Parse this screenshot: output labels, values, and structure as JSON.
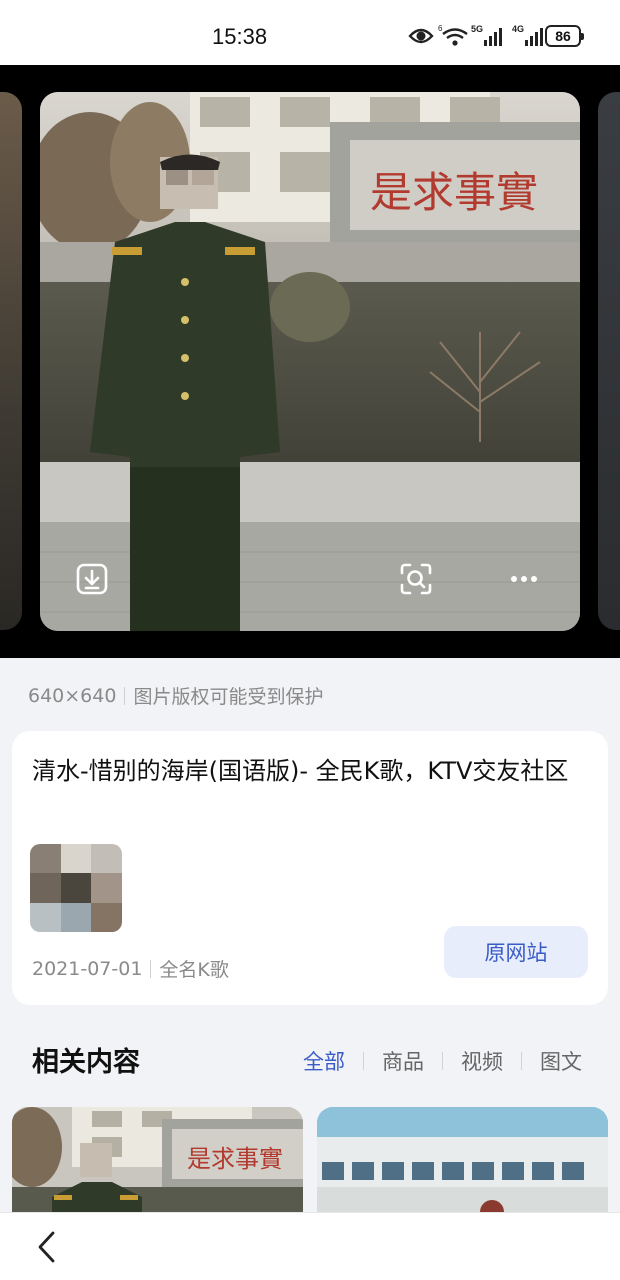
{
  "status_bar": {
    "time": "15:38",
    "battery": "86",
    "network_1": "5G",
    "network_2": "4G",
    "icons": [
      "eye-icon",
      "wifi-icon",
      "signal-icon",
      "signal-icon",
      "battery-icon"
    ]
  },
  "viewer": {
    "banner_text": "是求事實",
    "actions": [
      "download-icon",
      "lens-search-icon",
      "more-icon"
    ]
  },
  "image_info": {
    "dimensions": "640×640",
    "copyright_note": "图片版权可能受到保护"
  },
  "source_card": {
    "title": "清水-惜别的海岸(国语版)- 全民K歌，KTV交友社区",
    "date": "2021-07-01",
    "site": "全名K歌",
    "button_label": "原网站"
  },
  "related": {
    "heading": "相关内容",
    "tabs": [
      {
        "label": "全部",
        "active": true
      },
      {
        "label": "商品",
        "active": false
      },
      {
        "label": "视频",
        "active": false
      },
      {
        "label": "图文",
        "active": false
      }
    ],
    "thumb_banner_text": "是求事實"
  },
  "colors": {
    "accent": "#3a5cc8",
    "accent_bg": "#e8edfb",
    "page_bg": "#f2f3f6",
    "uniform_green": "#2f3a28"
  }
}
